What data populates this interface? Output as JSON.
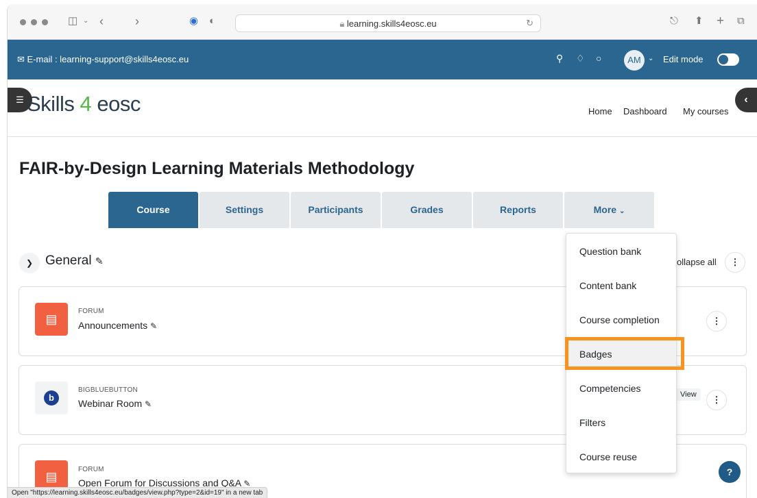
{
  "browser": {
    "url": "learning.skills4eosc.eu",
    "icons": [
      "sidebar-icon",
      "chevron-down-icon",
      "back-icon",
      "forward-icon",
      "shield-icon",
      "privacy-icon",
      "lock-icon",
      "reload-icon",
      "download-icon",
      "share-icon",
      "new-tab-icon",
      "tabs-icon"
    ]
  },
  "topbar": {
    "email": "E-mail : learning-support@skills4eosc.eu",
    "avatar": "AM",
    "edit_mode": "Edit mode",
    "bg_color": "#2b6690"
  },
  "header": {
    "logo_text": "Skills",
    "logo_num": "4",
    "logo_tail": "eosc",
    "nav": [
      "Home",
      "Dashboard",
      "My courses"
    ]
  },
  "page": {
    "title": "FAIR-by-Design Learning Materials Methodology"
  },
  "tabs": [
    "Course",
    "Settings",
    "Participants",
    "Grades",
    "Reports",
    "More"
  ],
  "section": {
    "title": "General",
    "collapse_all": "ollapse all"
  },
  "activities": [
    {
      "type": "FORUM",
      "name": "Announcements"
    },
    {
      "type": "BIGBLUEBUTTON",
      "name": "Webinar Room",
      "action": "View"
    },
    {
      "type": "FORUM",
      "name": "Open Forum for Discussions and Q&A"
    }
  ],
  "dropdown": {
    "items": [
      "Question bank",
      "Content bank",
      "Course completion",
      "Badges",
      "Competencies",
      "Filters",
      "Course reuse"
    ],
    "highlighted": "Badges",
    "highlight_color": "#f7931e"
  },
  "status_bar": "Open \"https://learning.skills4eosc.eu/badges/view.php?type=2&id=19\" in a new tab"
}
